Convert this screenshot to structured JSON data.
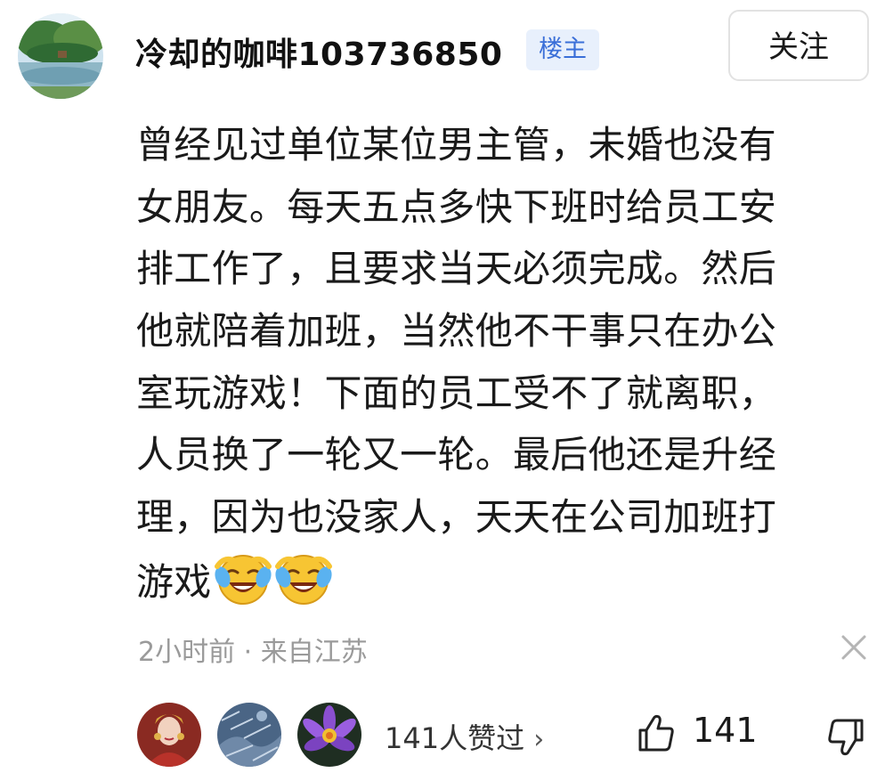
{
  "comment": {
    "author": {
      "name": "冷却的咖啡103736850",
      "badge": "楼主",
      "avatar_icon": "landscape-avatar-icon"
    },
    "follow_label": "关注",
    "text_lines": [
      "曾经见过单位某位男主管，未婚也没有",
      "女朋友。每天五点多快下班时给员工安",
      "排工作了，且要求当天必须完成。然后",
      "他就陪着加班，当然他不干事只在办公",
      "室玩游戏！下面的员工受不了就离职，",
      "人员换了一轮又一轮。最后他还是升经",
      "理，因为也没家人，天天在公司加班打",
      "游戏"
    ],
    "trailing_emojis": [
      "laughing-crying-emoji",
      "laughing-crying-emoji"
    ],
    "meta": "2小时前 · 来自江苏",
    "liked_by_text": "141人赞过",
    "like_count": "141"
  },
  "colors": {
    "badge_bg": "#e8f0fc",
    "badge_text": "#3a6fd8",
    "meta_text": "#9a9a9a"
  }
}
